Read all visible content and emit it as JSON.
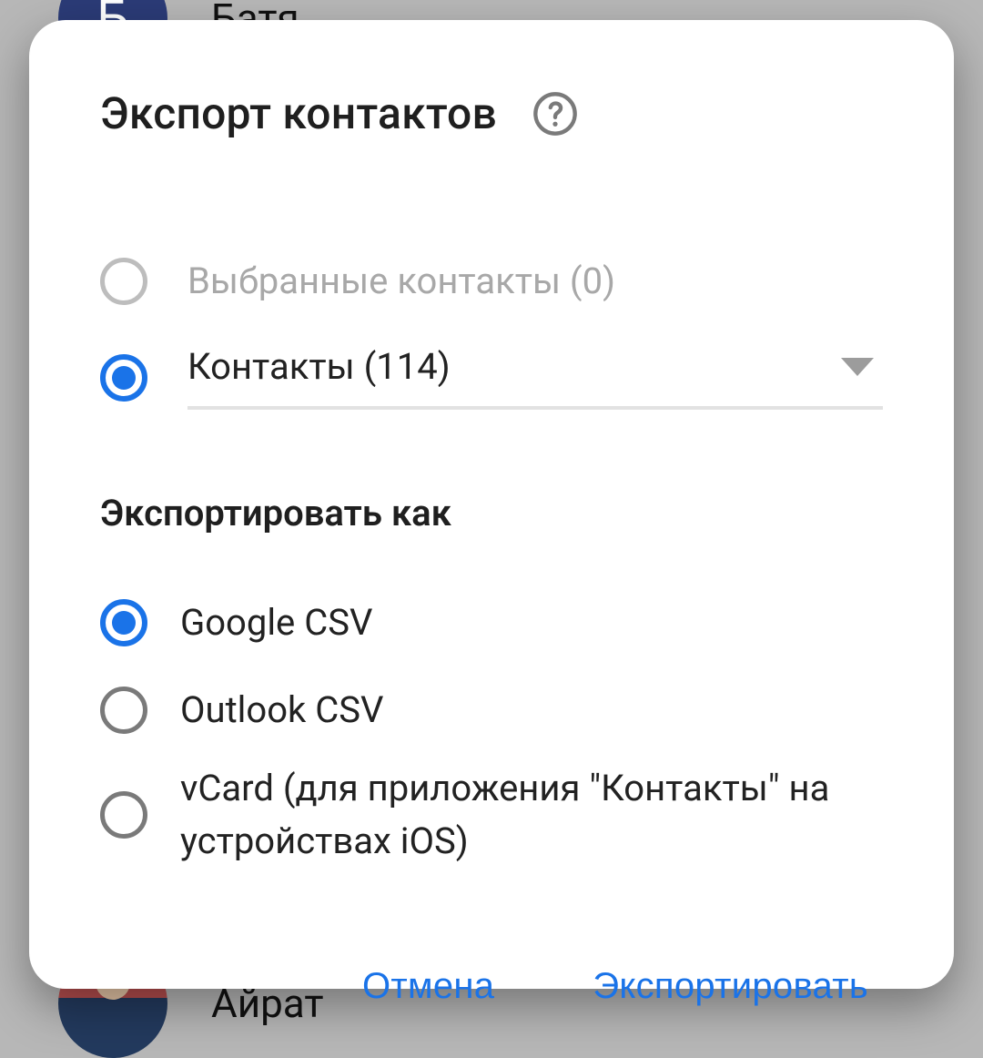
{
  "background": {
    "top_initial": "Б",
    "top_name": "Батя",
    "bottom_name": "Айрат"
  },
  "dialog": {
    "title": "Экспорт контактов",
    "source": {
      "selected_label": "Выбранные контакты (0)",
      "contacts_label": "Контакты (114)"
    },
    "export_as_heading": "Экспортировать как",
    "formats": {
      "google_csv": "Google CSV",
      "outlook_csv": "Outlook CSV",
      "vcard": "vCard (для приложения \"Контакты\" на устройствах iOS)"
    },
    "actions": {
      "cancel": "Отмена",
      "export": "Экспортировать"
    }
  },
  "colors": {
    "primary": "#1a73e8"
  }
}
